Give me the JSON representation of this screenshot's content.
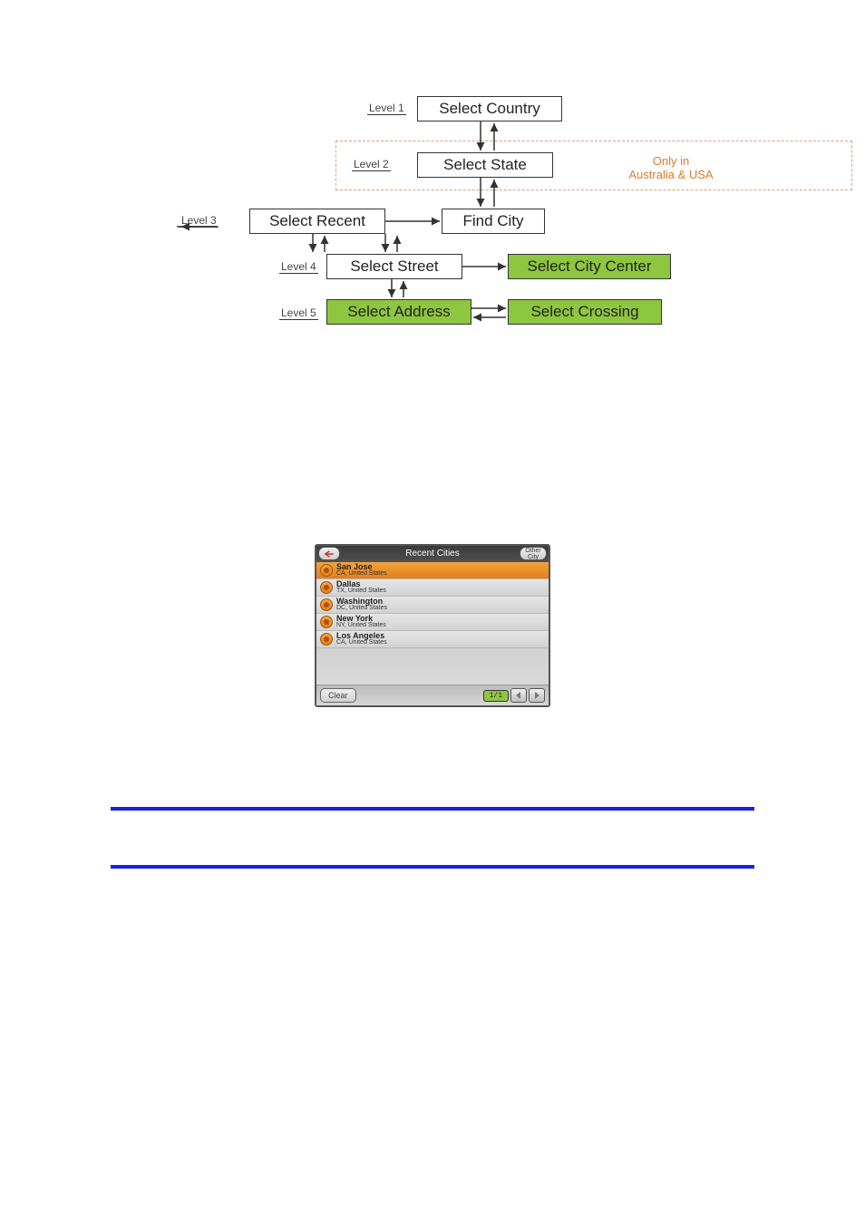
{
  "diagram": {
    "levels": [
      "Level 1",
      "Level 2",
      "Level 3",
      "Level 4",
      "Level 5"
    ],
    "nodes": {
      "select_country": "Select Country",
      "select_state": "Select State",
      "select_recent": "Select Recent",
      "find_city": "Find City",
      "select_street": "Select Street",
      "select_city_center": "Select City Center",
      "select_address": "Select Address",
      "select_crossing": "Select Crossing"
    },
    "note_line1": "Only in",
    "note_line2": "Australia & USA"
  },
  "gps": {
    "title": "Recent Cities",
    "other_btn": "Other City",
    "items": [
      {
        "city": "San Jose",
        "sub": "CA, United States",
        "selected": true
      },
      {
        "city": "Dallas",
        "sub": "TX, United States",
        "selected": false
      },
      {
        "city": "Washington",
        "sub": "DC, United States",
        "selected": false
      },
      {
        "city": "New York",
        "sub": "NY, United States",
        "selected": false
      },
      {
        "city": "Los Angeles",
        "sub": "CA, United States",
        "selected": false
      }
    ],
    "clear": "Clear",
    "page": "1/1"
  }
}
